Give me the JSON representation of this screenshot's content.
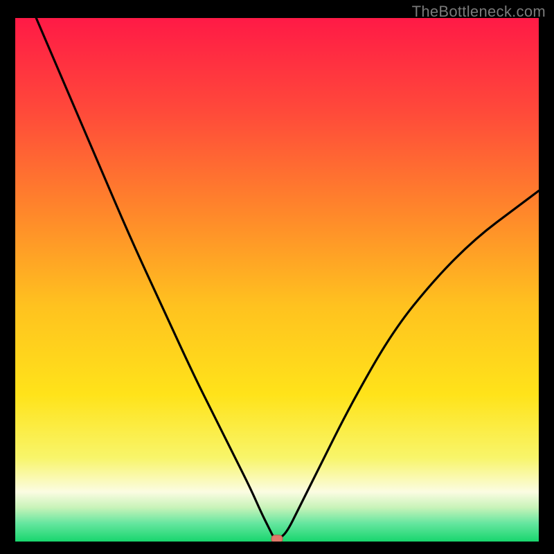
{
  "watermark": "TheBottleneck.com",
  "colors": {
    "frame": "#000000",
    "watermark": "#7a7a7a",
    "curve": "#000000",
    "marker_fill": "#e07a6a",
    "marker_stroke": "#b85c4e",
    "gradient_stops": [
      {
        "offset": 0.0,
        "color": "#ff1a46"
      },
      {
        "offset": 0.18,
        "color": "#ff4a3a"
      },
      {
        "offset": 0.38,
        "color": "#ff8a2a"
      },
      {
        "offset": 0.55,
        "color": "#ffc21f"
      },
      {
        "offset": 0.72,
        "color": "#ffe31a"
      },
      {
        "offset": 0.84,
        "color": "#f8f56a"
      },
      {
        "offset": 0.905,
        "color": "#fbfce2"
      },
      {
        "offset": 0.935,
        "color": "#c8f3b9"
      },
      {
        "offset": 0.965,
        "color": "#66e6a0"
      },
      {
        "offset": 1.0,
        "color": "#18d66d"
      }
    ]
  },
  "chart_data": {
    "type": "line",
    "title": "",
    "xlabel": "",
    "ylabel": "",
    "xlim": [
      0,
      100
    ],
    "ylim": [
      0,
      100
    ],
    "grid": false,
    "legend": false,
    "annotations": [
      {
        "text": "TheBottleneck.com",
        "role": "watermark"
      }
    ],
    "series": [
      {
        "name": "bottleneck-curve",
        "x": [
          4,
          10,
          16,
          22,
          28,
          34,
          38,
          42,
          45,
          47,
          48.5,
          49.5,
          50.5,
          52,
          54,
          58,
          64,
          72,
          80,
          88,
          96,
          100
        ],
        "y": [
          100,
          86,
          72,
          58,
          45,
          32,
          24,
          16,
          10,
          5.5,
          2.5,
          0.5,
          0.5,
          2.0,
          6,
          14,
          26,
          40,
          50,
          58,
          64,
          67
        ]
      }
    ],
    "marker": {
      "x": 50,
      "y": 0.5,
      "shape": "rounded-rect"
    }
  }
}
